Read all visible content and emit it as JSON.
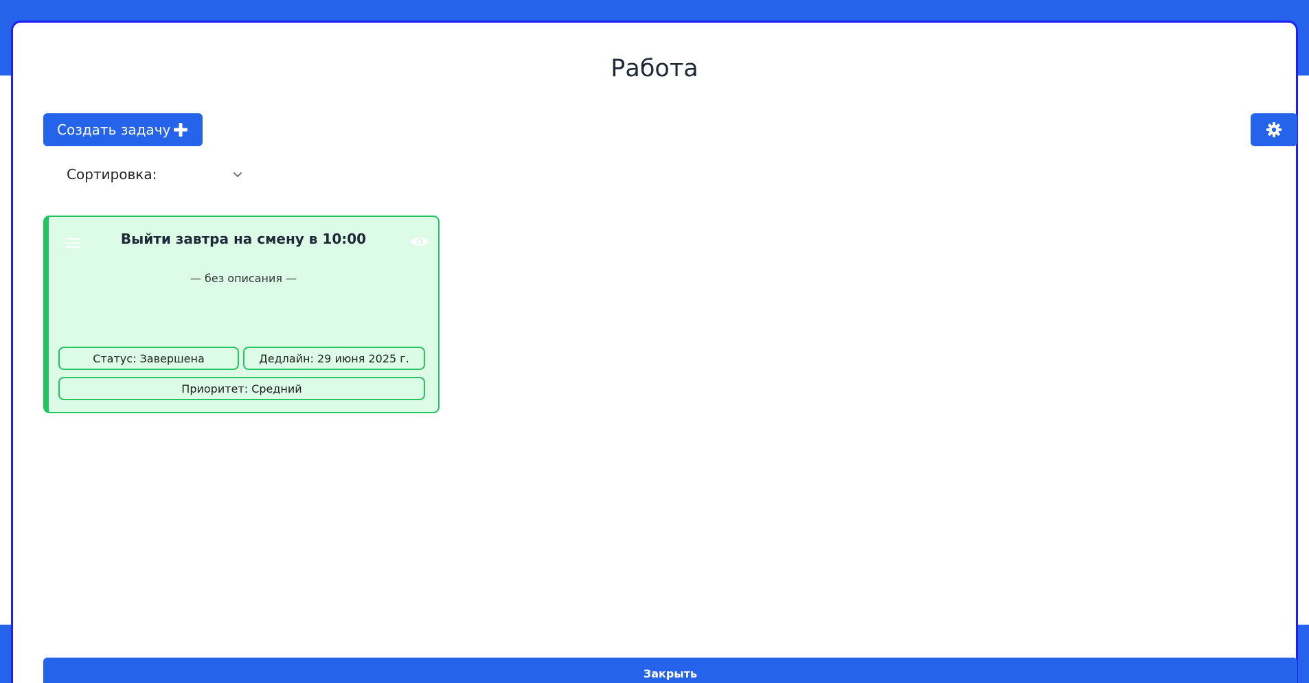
{
  "modal": {
    "title": "Работа"
  },
  "toolbar": {
    "create_label": "Создать задачу",
    "create_icon": "plus-icon",
    "settings_icon": "gear-icon"
  },
  "sort": {
    "label": "Сортировка:",
    "icon": "chevron-down-icon"
  },
  "tasks": [
    {
      "title": "Выйти завтра на смену в 10:00",
      "description": "— без описания —",
      "status": "Статус: Завершена",
      "deadline": "Дедлайн: 29 июня 2025 г.",
      "priority": "Приоритет: Средний",
      "accent_color": "#22c55e",
      "background_color": "#dcfce7"
    }
  ],
  "footer": {
    "close_label": "Закрыть"
  },
  "colors": {
    "primary": "#2563eb",
    "modal_border": "#1d1dff",
    "success": "#22c55e"
  }
}
